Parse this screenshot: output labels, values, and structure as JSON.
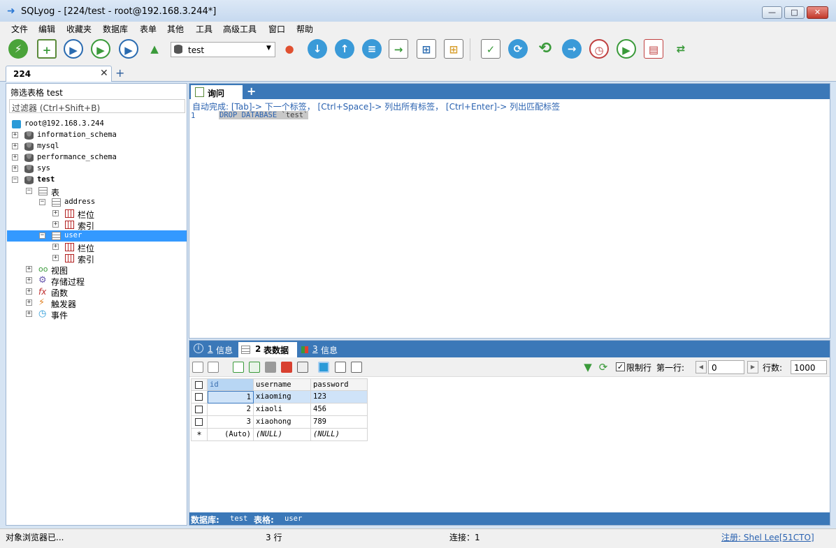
{
  "window": {
    "title": "SQLyog - [224/test - root@192.168.3.244*]",
    "min": "—",
    "max": "□",
    "close": "✕"
  },
  "menu": [
    "文件",
    "编辑",
    "收藏夹",
    "数据库",
    "表单",
    "其他",
    "工具",
    "高级工具",
    "窗口",
    "帮助"
  ],
  "toolbar": {
    "database_selected": "test",
    "dropdown_arrow": "▼"
  },
  "connection_tab": {
    "label": "224",
    "close": "✕",
    "add": "+"
  },
  "object_browser": {
    "filter_label": "筛选表格 test",
    "filter_placeholder": "过滤器 (Ctrl+Shift+B)",
    "tree": {
      "server": "root@192.168.3.244",
      "databases": [
        "information_schema",
        "mysql",
        "performance_schema",
        "sys",
        "test"
      ],
      "tables_folder": "表",
      "table_address": "address",
      "columns": "栏位",
      "indexes": "索引",
      "table_user": "user",
      "views": "视图",
      "procedures": "存储过程",
      "functions": "函数",
      "triggers": "触发器",
      "events": "事件"
    }
  },
  "query": {
    "tab_label": "询问",
    "add": "+",
    "autocomplete_hint": "自动完成: [Tab]-> 下一个标签， [Ctrl+Space]-> 列出所有标签， [Ctrl+Enter]-> 列出匹配标签",
    "line_no": "1",
    "sql_keyword": "DROP DATABASE",
    "sql_name": "`test`"
  },
  "results": {
    "tabs": {
      "info_no": "1",
      "info": "信息",
      "table_no": "2",
      "table": "表数据",
      "info3_no": "3",
      "info3": "信息"
    },
    "limit_label": "限制行",
    "limit_checked": "✓",
    "first_row_label": "第一行:",
    "first_row_value": "0",
    "row_count_label": "行数:",
    "row_count_value": "1000",
    "columns": [
      "id",
      "username",
      "password"
    ],
    "rows": [
      {
        "id": "1",
        "username": "xiaoming",
        "password": "123"
      },
      {
        "id": "2",
        "username": "xiaoli",
        "password": "456"
      },
      {
        "id": "3",
        "username": "xiaohong",
        "password": "789"
      }
    ],
    "new_row": {
      "marker": "*",
      "id": "(Auto)",
      "username": "(NULL)",
      "password": "(NULL)"
    },
    "status_db_label": "数据库:",
    "status_db": "test",
    "status_table_label": "表格:",
    "status_table": "user"
  },
  "statusbar": {
    "left": "对象浏览器已...",
    "rows": "3 行",
    "connection": "连接：1",
    "registration": "注册: Shel Lee[51CTO]"
  },
  "colors": {
    "accent": "#3b78b8",
    "selection": "#3399ff"
  }
}
